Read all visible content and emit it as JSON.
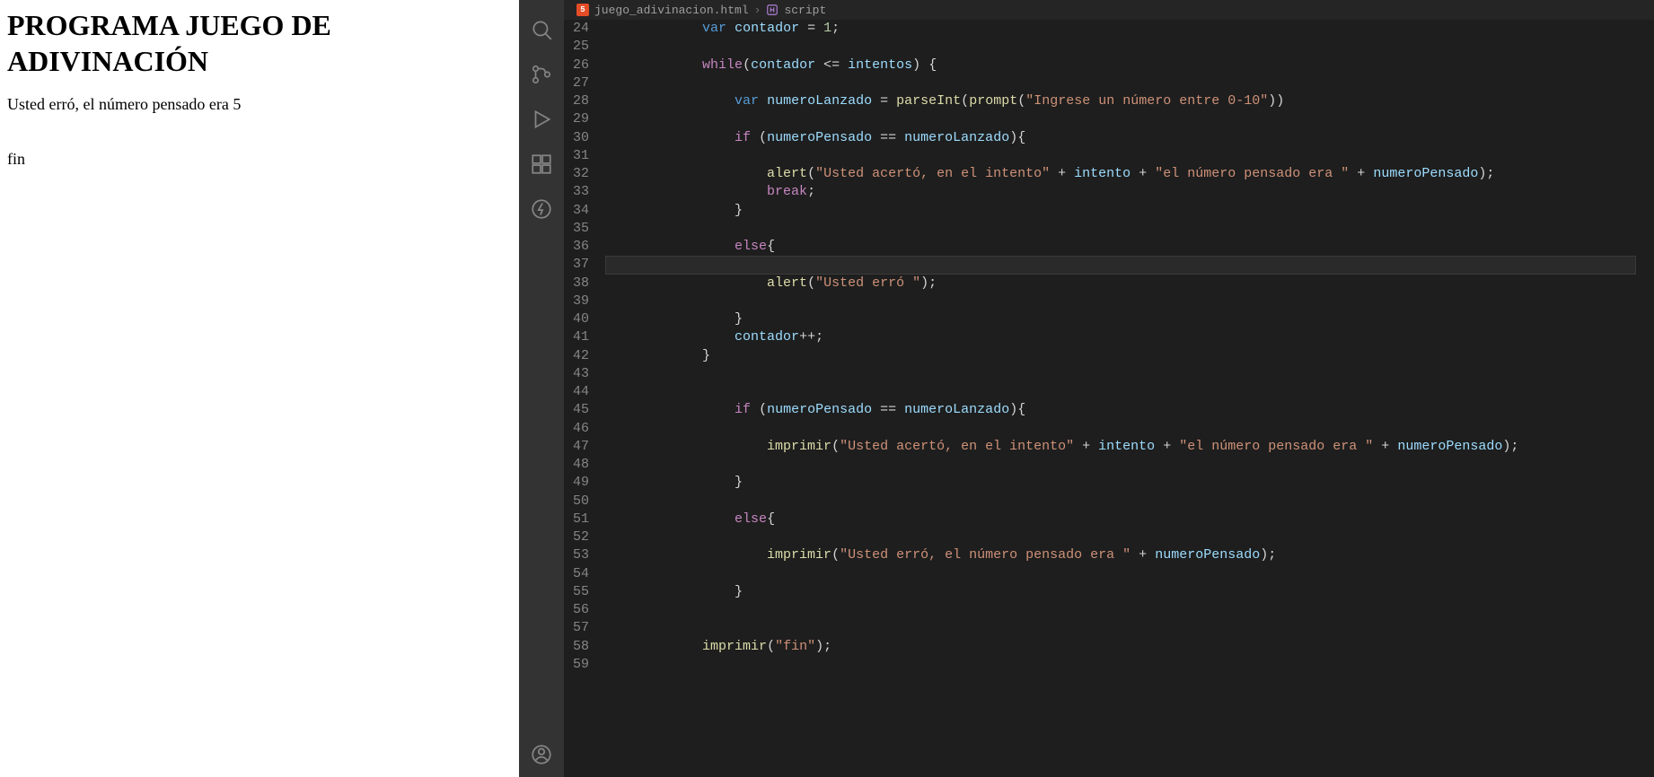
{
  "browser": {
    "heading": "PROGRAMA JUEGO DE ADIVINACIÓN",
    "line1": "Usted erró, el número pensado era 5",
    "line2": "fin"
  },
  "activityBar": {
    "icons": [
      "search-icon",
      "source-control-icon",
      "run-debug-icon",
      "extensions-icon",
      "thunder-icon"
    ],
    "bottomIcons": [
      "account-icon"
    ]
  },
  "breadcrumb": {
    "fileIconLetter": "5",
    "fileName": "juego_adivinacion.html",
    "chevron": "›",
    "symbolName": "script"
  },
  "code": {
    "startLine": 24,
    "cursorLine": 37,
    "lines": [
      [
        [
          "sp",
          "            "
        ],
        [
          "kw",
          "var"
        ],
        [
          "sp",
          " "
        ],
        [
          "var",
          "contador"
        ],
        [
          "sp",
          " "
        ],
        [
          "op",
          "="
        ],
        [
          "sp",
          " "
        ],
        [
          "num",
          "1"
        ],
        [
          "pun",
          ";"
        ]
      ],
      [],
      [
        [
          "sp",
          "            "
        ],
        [
          "ctrl",
          "while"
        ],
        [
          "pun",
          "("
        ],
        [
          "var",
          "contador"
        ],
        [
          "sp",
          " "
        ],
        [
          "op",
          "<="
        ],
        [
          "sp",
          " "
        ],
        [
          "var",
          "intentos"
        ],
        [
          "pun",
          ")"
        ],
        [
          "sp",
          " "
        ],
        [
          "pun",
          "{"
        ]
      ],
      [],
      [
        [
          "sp",
          "                "
        ],
        [
          "kw",
          "var"
        ],
        [
          "sp",
          " "
        ],
        [
          "var",
          "numeroLanzado"
        ],
        [
          "sp",
          " "
        ],
        [
          "op",
          "="
        ],
        [
          "sp",
          " "
        ],
        [
          "fn",
          "parseInt"
        ],
        [
          "pun",
          "("
        ],
        [
          "fn",
          "prompt"
        ],
        [
          "pun",
          "("
        ],
        [
          "str",
          "\"Ingrese un número entre 0-10\""
        ],
        [
          "pun",
          "))"
        ]
      ],
      [],
      [
        [
          "sp",
          "                "
        ],
        [
          "ctrl",
          "if"
        ],
        [
          "sp",
          " "
        ],
        [
          "pun",
          "("
        ],
        [
          "var",
          "numeroPensado"
        ],
        [
          "sp",
          " "
        ],
        [
          "op",
          "=="
        ],
        [
          "sp",
          " "
        ],
        [
          "var",
          "numeroLanzado"
        ],
        [
          "pun",
          ")"
        ],
        [
          "pun",
          "{"
        ]
      ],
      [],
      [
        [
          "sp",
          "                    "
        ],
        [
          "fn",
          "alert"
        ],
        [
          "pun",
          "("
        ],
        [
          "str",
          "\"Usted acertó, en el intento\""
        ],
        [
          "sp",
          " "
        ],
        [
          "op",
          "+"
        ],
        [
          "sp",
          " "
        ],
        [
          "var",
          "intento"
        ],
        [
          "sp",
          " "
        ],
        [
          "op",
          "+"
        ],
        [
          "sp",
          " "
        ],
        [
          "str",
          "\"el número pensado era \""
        ],
        [
          "sp",
          " "
        ],
        [
          "op",
          "+"
        ],
        [
          "sp",
          " "
        ],
        [
          "var",
          "numeroPensado"
        ],
        [
          "pun",
          ");"
        ]
      ],
      [
        [
          "sp",
          "                    "
        ],
        [
          "ctrl",
          "break"
        ],
        [
          "pun",
          ";"
        ]
      ],
      [
        [
          "sp",
          "                "
        ],
        [
          "pun",
          "}"
        ]
      ],
      [],
      [
        [
          "sp",
          "                "
        ],
        [
          "ctrl",
          "else"
        ],
        [
          "pun",
          "{"
        ]
      ],
      [],
      [
        [
          "sp",
          "                    "
        ],
        [
          "fn",
          "alert"
        ],
        [
          "pun",
          "("
        ],
        [
          "str",
          "\"Usted erró \""
        ],
        [
          "pun",
          ");"
        ]
      ],
      [],
      [
        [
          "sp",
          "                "
        ],
        [
          "pun",
          "}"
        ]
      ],
      [
        [
          "sp",
          "                "
        ],
        [
          "var",
          "contador"
        ],
        [
          "op",
          "++"
        ],
        [
          "pun",
          ";"
        ]
      ],
      [
        [
          "sp",
          "            "
        ],
        [
          "pun",
          "}"
        ]
      ],
      [],
      [],
      [
        [
          "sp",
          "                "
        ],
        [
          "ctrl",
          "if"
        ],
        [
          "sp",
          " "
        ],
        [
          "pun",
          "("
        ],
        [
          "var",
          "numeroPensado"
        ],
        [
          "sp",
          " "
        ],
        [
          "op",
          "=="
        ],
        [
          "sp",
          " "
        ],
        [
          "var",
          "numeroLanzado"
        ],
        [
          "pun",
          ")"
        ],
        [
          "pun",
          "{"
        ]
      ],
      [],
      [
        [
          "sp",
          "                    "
        ],
        [
          "fn",
          "imprimir"
        ],
        [
          "pun",
          "("
        ],
        [
          "str",
          "\"Usted acertó, en el intento\""
        ],
        [
          "sp",
          " "
        ],
        [
          "op",
          "+"
        ],
        [
          "sp",
          " "
        ],
        [
          "var",
          "intento"
        ],
        [
          "sp",
          " "
        ],
        [
          "op",
          "+"
        ],
        [
          "sp",
          " "
        ],
        [
          "str",
          "\"el número pensado era \""
        ],
        [
          "sp",
          " "
        ],
        [
          "op",
          "+"
        ],
        [
          "sp",
          " "
        ],
        [
          "var",
          "numeroPensado"
        ],
        [
          "pun",
          ");"
        ]
      ],
      [],
      [
        [
          "sp",
          "                "
        ],
        [
          "pun",
          "}"
        ]
      ],
      [],
      [
        [
          "sp",
          "                "
        ],
        [
          "ctrl",
          "else"
        ],
        [
          "pun",
          "{"
        ]
      ],
      [],
      [
        [
          "sp",
          "                    "
        ],
        [
          "fn",
          "imprimir"
        ],
        [
          "pun",
          "("
        ],
        [
          "str",
          "\"Usted erró, el número pensado era \""
        ],
        [
          "sp",
          " "
        ],
        [
          "op",
          "+"
        ],
        [
          "sp",
          " "
        ],
        [
          "var",
          "numeroPensado"
        ],
        [
          "pun",
          ");"
        ]
      ],
      [],
      [
        [
          "sp",
          "                "
        ],
        [
          "pun",
          "}"
        ]
      ],
      [],
      [],
      [
        [
          "sp",
          "            "
        ],
        [
          "fn",
          "imprimir"
        ],
        [
          "pun",
          "("
        ],
        [
          "str",
          "\"fin\""
        ],
        [
          "pun",
          ");"
        ]
      ],
      []
    ]
  }
}
